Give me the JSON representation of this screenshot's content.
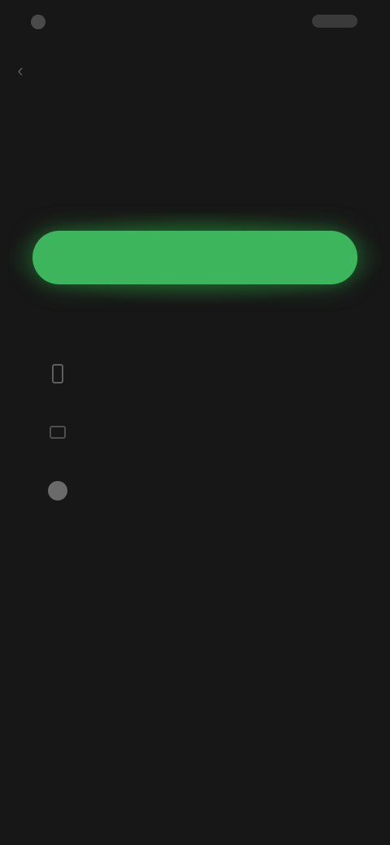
{
  "status_bar": {
    "time": "",
    "icons": [
      "signal-icon",
      "wifi-icon",
      "battery-icon"
    ]
  },
  "header": {
    "back_icon": "back-arrow-icon",
    "title": ""
  },
  "section": {
    "label": ""
  },
  "primary_action": {
    "label": "",
    "color": "#3cb55c"
  },
  "secondary_link": {
    "label": ""
  },
  "options": [
    {
      "icon": "phone-icon",
      "label": ""
    },
    {
      "icon": "mail-icon",
      "label": ""
    },
    {
      "icon": "account-icon",
      "label": ""
    }
  ],
  "footer": {
    "text": "",
    "link": ""
  },
  "colors": {
    "background": "#171717",
    "accent": "#3cb55c"
  }
}
